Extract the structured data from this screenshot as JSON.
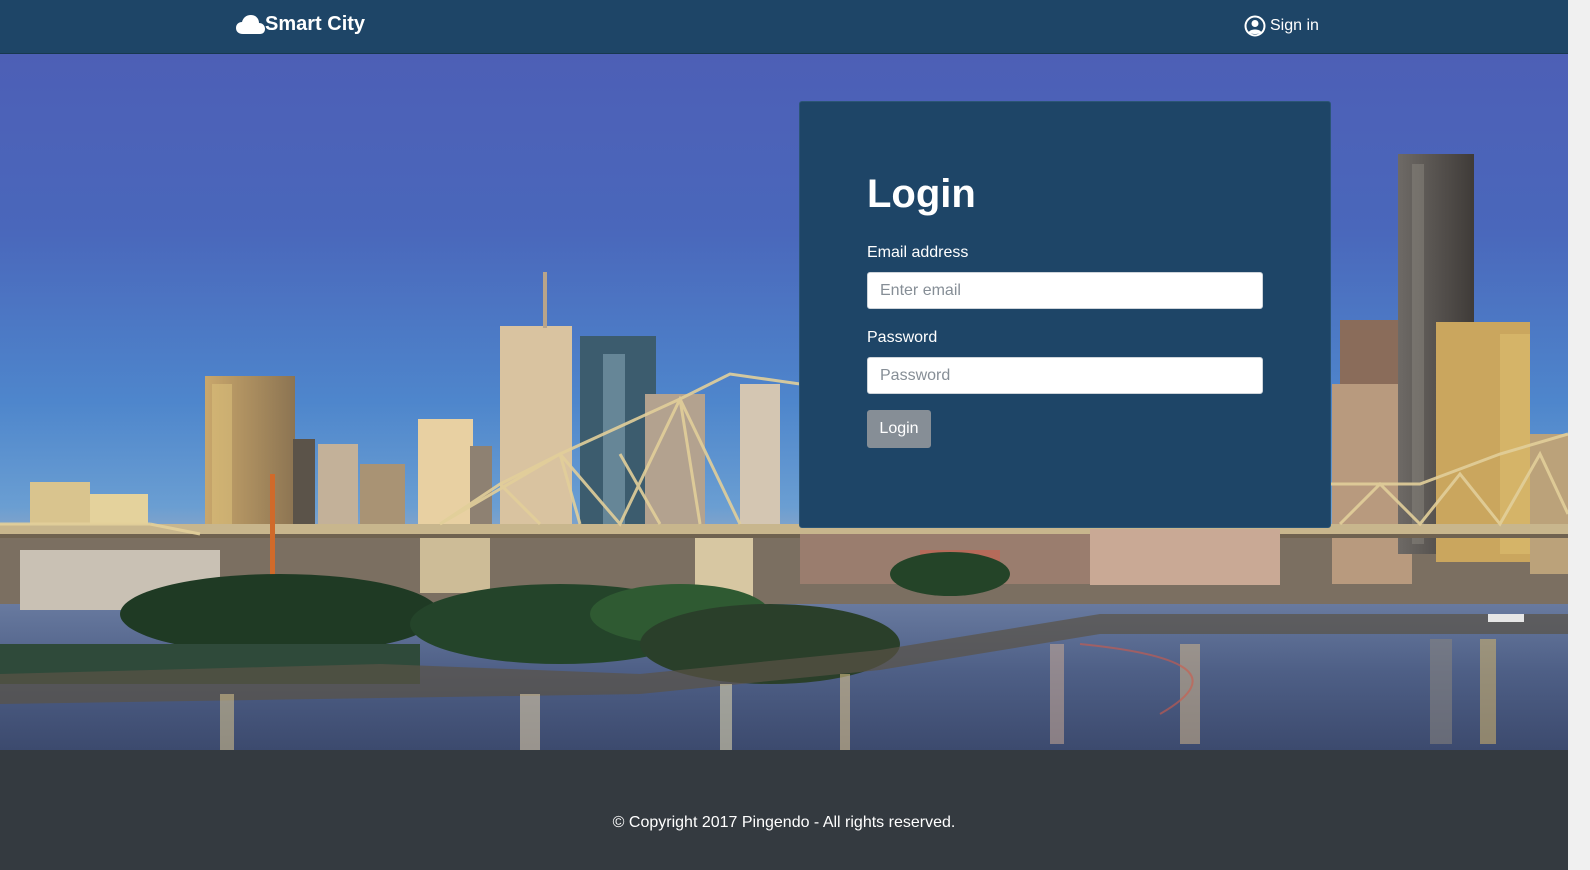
{
  "navbar": {
    "brand": "Smart City",
    "brand_icon": "cloud-icon",
    "signin_label": "Sign in",
    "signin_icon": "user-circle-icon"
  },
  "login": {
    "title": "Login",
    "email_label": "Email address",
    "email_placeholder": "Enter email",
    "email_value": "",
    "password_label": "Password",
    "password_placeholder": "Password",
    "password_value": "",
    "submit_label": "Login"
  },
  "footer": {
    "copyright": "© Copyright 2017 Pingendo - All rights reserved."
  },
  "colors": {
    "navbar_bg": "#1e4567",
    "card_bg": "#1e4567",
    "footer_bg": "#343a40",
    "button_bg": "#868e96"
  }
}
